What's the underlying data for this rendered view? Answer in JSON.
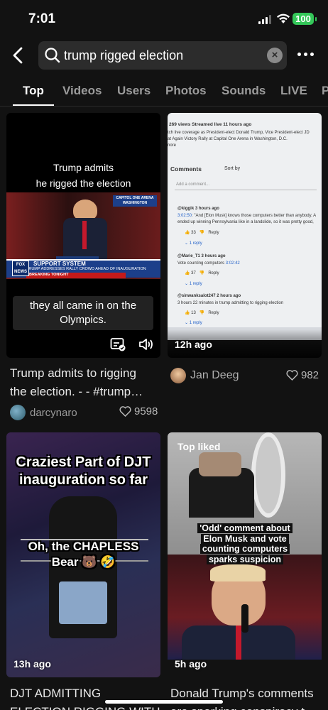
{
  "status_bar": {
    "time": "7:01",
    "battery": "100"
  },
  "search": {
    "query": "trump rigged election",
    "clear_label": "×"
  },
  "tabs": [
    {
      "label": "Top",
      "active": true
    },
    {
      "label": "Videos",
      "active": false
    },
    {
      "label": "Users",
      "active": false
    },
    {
      "label": "Photos",
      "active": false
    },
    {
      "label": "Sounds",
      "active": false
    },
    {
      "label": "LIVE",
      "active": false
    },
    {
      "label": "P",
      "active": false
    }
  ],
  "results": [
    {
      "overlay_title_1": "Trump admits",
      "overlay_title_2": "he rigged the election",
      "chyron_top": "CAPITOL ONE ARENA",
      "chyron_top_2": "WASHINGTON",
      "chyron_main": "SUPPORT SYSTEM",
      "chyron_sub": "TRUMP ADDRESSES RALLY CROWD AHEAD OF INAUGURATION",
      "chyron_breaking": "BREAKING TONIGHT",
      "network_logo": "FOX NEWS",
      "subtitle": "they all came in on the Olympics.",
      "caption": "Trump admits to rigging the election.  - - #trump…",
      "author": "darcynaro",
      "likes": "9598"
    },
    {
      "shot_views": "269 views  Streamed live 11 hours ago",
      "shot_desc_1": "tch live coverage as President-elect Donald Trump, Vice President-elect JD",
      "shot_desc_2": "at Again Victory Rally at Capital One Arena in Washington, D.C.",
      "shot_more": "nore",
      "shot_comments": "Comments",
      "shot_sort": "Sort by",
      "shot_add": "Add a comment...",
      "c1_user": "@kiggik  3 hours ago",
      "c1_ts": "3:02:50",
      "c1_text_1": ": \"And [Elon Musk] knows those computers better than anybody. A",
      "c1_text_2": "ended up winning Pennsylvania like in a landslide, so it was pretty good,",
      "c1_likes": "33",
      "c1_replies": "1 reply",
      "c2_user": "@Marie_T1  3 hours ago",
      "c2_text": "Vote counting computers ",
      "c2_ts": "3:02:42",
      "c2_likes": "37",
      "c2_replies": "1 reply",
      "c3_user": "@sinwanksalot247  2 hours ago",
      "c3_text": "3 hours 22 minutes in trump admitting to rigging election",
      "c3_likes": "13",
      "c3_replies": "1 reply",
      "reply_label": "Reply",
      "age": "12h ago",
      "author": "Jan Deeg",
      "likes": "982"
    },
    {
      "overlay_1": "Craziest Part of DJT inauguration so far",
      "overlay_2": "Oh, the CHAPLESS Bear 🐻 🤣",
      "age": "13h ago",
      "caption": "DJT ADMITTING ELECTION RIGGING WITH ELON #d"
    },
    {
      "badge": "Top liked",
      "overlay": "'Odd' comment about Elon Musk and vote counting computers sparks suspicion",
      "age": "5h ago",
      "caption": "Donald Trump's comments are sparking conspiracy t"
    }
  ],
  "colors": {
    "background": "#121212",
    "battery": "#34c759",
    "chyron_blue": "#1c3f8a",
    "link_blue": "#2563c9"
  }
}
